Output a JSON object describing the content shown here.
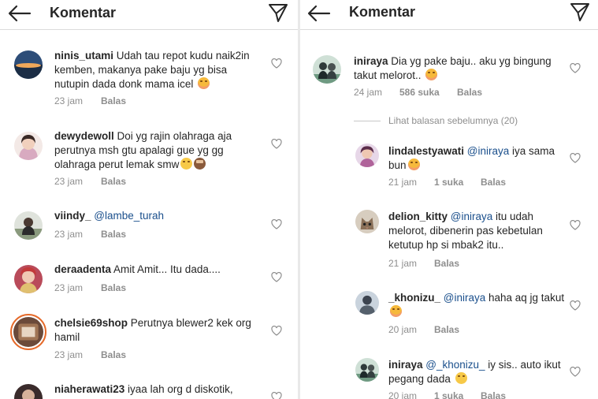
{
  "left": {
    "title": "Komentar",
    "comments": [
      {
        "username": "ninis_utami",
        "text": " Udah tau repot kudu naik2in kemben, makanya pake baju yg bisa nutupin dada donk mama icel ",
        "time": "23 jam",
        "reply": "Balas"
      },
      {
        "username": "dewydewoll",
        "text": " Doi yg rajin olahraga aja perutnya msh gtu apalagi gue yg gg olahraga perut lemak smw",
        "time": "23 jam",
        "reply": "Balas"
      },
      {
        "username": "viindy_",
        "mention": " @lambe_turah",
        "time": "23 jam",
        "reply": "Balas"
      },
      {
        "username": "deraadenta",
        "text": " Amit Amit... Itu dada....",
        "time": "23 jam",
        "reply": "Balas"
      },
      {
        "username": "chelsie69shop",
        "text": " Perutnya blewer2 kek org hamil",
        "time": "23 jam",
        "reply": "Balas"
      },
      {
        "username": "niaherawati23",
        "text": " iyaa lah org d diskotik,"
      }
    ]
  },
  "right": {
    "title": "Komentar",
    "main_comment": {
      "username": "iniraya",
      "text": " Dia yg pake baju.. aku yg bingung takut melorot.. ",
      "time": "24 jam",
      "likes": "586 suka",
      "reply": "Balas"
    },
    "view_previous": "Lihat balasan sebelumnya (20)",
    "replies": [
      {
        "username": "lindalestyawati",
        "mention": " @iniraya",
        "text": " iya sama bun",
        "time": "21 jam",
        "likes": "1 suka",
        "reply": "Balas"
      },
      {
        "username": "delion_kitty",
        "mention": " @iniraya",
        "text": " itu udah melorot, dibenerin pas kebetulan ketutup hp si mbak2 itu..",
        "time": "21 jam",
        "reply": "Balas"
      },
      {
        "username": "_khonizu_",
        "mention": " @iniraya",
        "text": " haha aq jg takut ",
        "time": "20 jam",
        "reply": "Balas"
      },
      {
        "username": "iniraya",
        "mention": " @_khonizu_",
        "text": " iy sis.. auto ikut pegang dada ",
        "time": "20 jam",
        "likes": "1 suka",
        "reply": "Balas"
      }
    ]
  },
  "colors": {
    "text": "#262626",
    "secondary": "#8e8e8e",
    "mention": "#1a4f8c",
    "story_ring": "#e56a2a"
  }
}
